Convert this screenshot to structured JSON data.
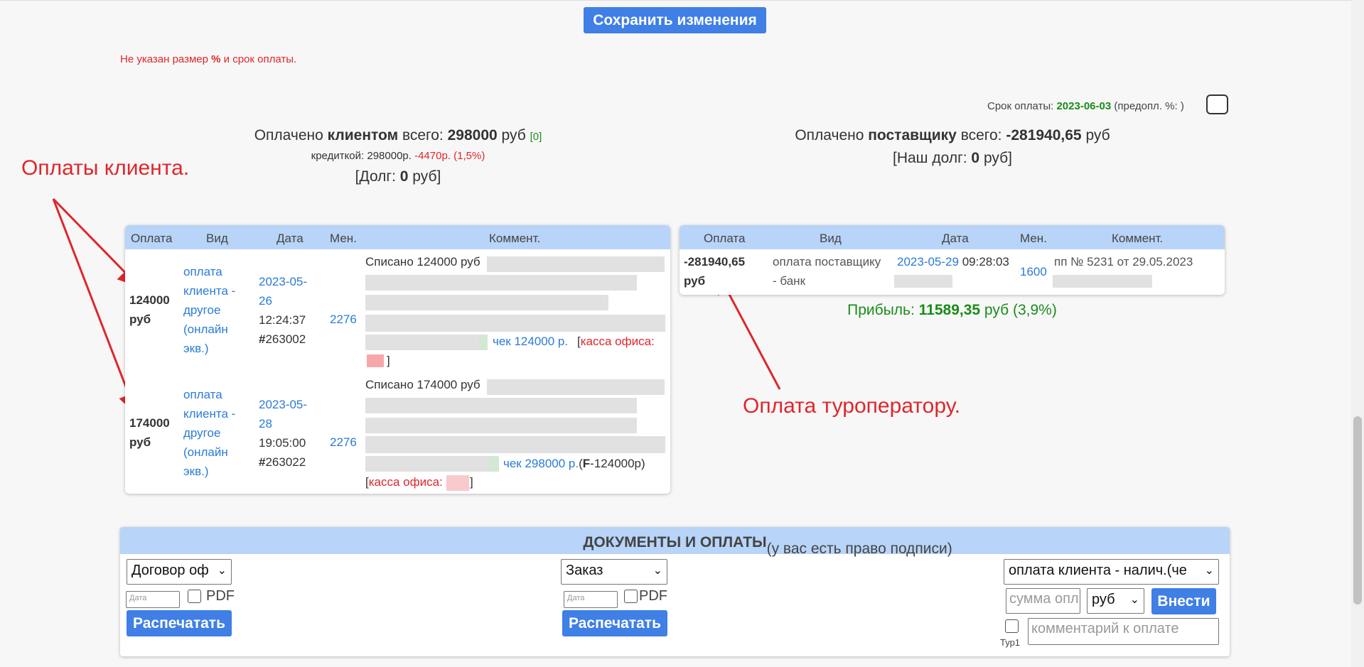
{
  "save_button": "Сохранить изменения",
  "warning": {
    "pre": "Не указан размер ",
    "pct": "%",
    "post": " и срок оплаты."
  },
  "due": {
    "label": "Срок оплаты: ",
    "date": "2023-06-03",
    "prepay": " (предопл. %: )"
  },
  "client_summary": {
    "pre": "Оплачено ",
    "who": "клиентом",
    "mid": " всего: ",
    "amount": "298000",
    "unit": " руб ",
    "count": "[0]",
    "credit_pre": "кредиткой: 298000р. ",
    "credit_fee": "-4470р. (1,5%)",
    "debt_pre": "[Долг: ",
    "debt": "0",
    "debt_post": " руб]"
  },
  "supplier_summary": {
    "pre": "Оплачено ",
    "who": "поставщику",
    "mid": " всего: ",
    "amount": "-281940,65",
    "unit": " руб",
    "debt_pre": "[Наш долг: ",
    "debt": "0",
    "debt_post": " руб]"
  },
  "annotations": {
    "client": "Оплаты клиента.",
    "operator": "Оплата туроператору."
  },
  "client_table": {
    "headers": [
      "Оплата",
      "Вид",
      "Дата",
      "Мен.",
      "Коммент."
    ],
    "rows": [
      {
        "amount_l1": "124000",
        "amount_l2": "руб",
        "kind_lines": [
          "оплата",
          "клиента -",
          "другое",
          "(онлайн",
          "экв.)"
        ],
        "date_l1": "2023-05-",
        "date_l2": "26",
        "time": "12:24:37",
        "num_hash": "#",
        "num": "263002",
        "manager": "2276",
        "comment": "Списано 124000 руб",
        "check": "чек 124000 р.",
        "bracket_open": "[",
        "kassa": "касса офиса:",
        "bracket_close": "]"
      },
      {
        "amount_l1": "174000",
        "amount_l2": "руб",
        "kind_lines": [
          "оплата",
          "клиента -",
          "другое",
          "(онлайн",
          "экв.)"
        ],
        "date_l1": "2023-05-",
        "date_l2": "28",
        "time": "19:05:00",
        "num_hash": "#",
        "num": "263022",
        "manager": "2276",
        "comment": "Списано 174000 руб",
        "check": "чек 298000 р.",
        "f_open": "(",
        "f_letter": "F",
        "f_rest": "-124000р)",
        "bracket_open": "[",
        "kassa": "касса офиса:",
        "bracket_close": "]"
      }
    ]
  },
  "supplier_table": {
    "headers": [
      "Оплата",
      "Вид",
      "Дата",
      "Мен.",
      "Коммент."
    ],
    "row": {
      "amount_l1": "-281940,65",
      "amount_l2": "руб",
      "kind_l1": "оплата поставщику",
      "kind_l2": "- банк",
      "date": "2023-05-29",
      "time": " 09:28:03",
      "manager": "1600",
      "comment": "пп № 5231 от 29.05.2023"
    }
  },
  "profit": {
    "label": "Прибыль: ",
    "amount": "11589,35",
    "rest": " руб (3,9%)"
  },
  "documents": {
    "title": "ДОКУМЕНТЫ И ОПЛАТЫ",
    "subtitle": " (у вас есть право подписи)",
    "select1": "Договор оф",
    "select2": "Заказ",
    "date_placeholder": "Дата",
    "pdf": "PDF",
    "print": "Распечатать",
    "pay_type": "оплата клиента - налич.(че",
    "sum_placeholder": "сумма опл",
    "currency": "руб",
    "submit": "Внести",
    "tour_label": "Тур1",
    "comment_placeholder": "комментарий к оплате"
  },
  "colors": {
    "accent": "#3f7fe6",
    "table_header": "#b8d4f8",
    "link": "#2a7bd6",
    "warning": "#e0262b",
    "profit": "#1a8c1a"
  }
}
